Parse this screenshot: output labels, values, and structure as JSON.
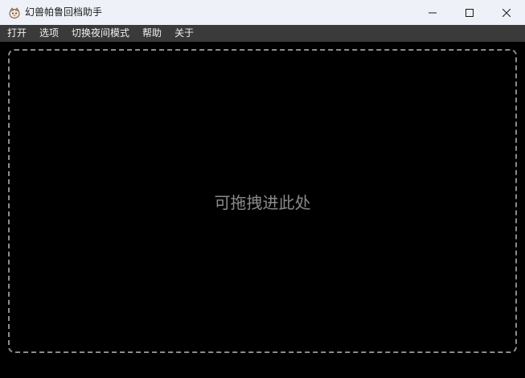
{
  "window": {
    "title": "幻兽帕鲁回档助手",
    "app_icon": "pal-icon",
    "controls": {
      "minimize_icon": "minimize-icon",
      "maximize_icon": "maximize-icon",
      "close_icon": "close-icon"
    }
  },
  "menubar": {
    "items": [
      {
        "label": "打开"
      },
      {
        "label": "选项"
      },
      {
        "label": "切换夜间模式"
      },
      {
        "label": "帮助"
      },
      {
        "label": "关于"
      }
    ]
  },
  "dropzone": {
    "label": "可拖拽进此处"
  },
  "colors": {
    "titlebar_bg": "#eef1f8",
    "menubar_bg": "#3a3a3a",
    "content_bg": "#000000",
    "dropzone_border": "#8c8c8c",
    "dropzone_text": "#8a8a8a"
  }
}
